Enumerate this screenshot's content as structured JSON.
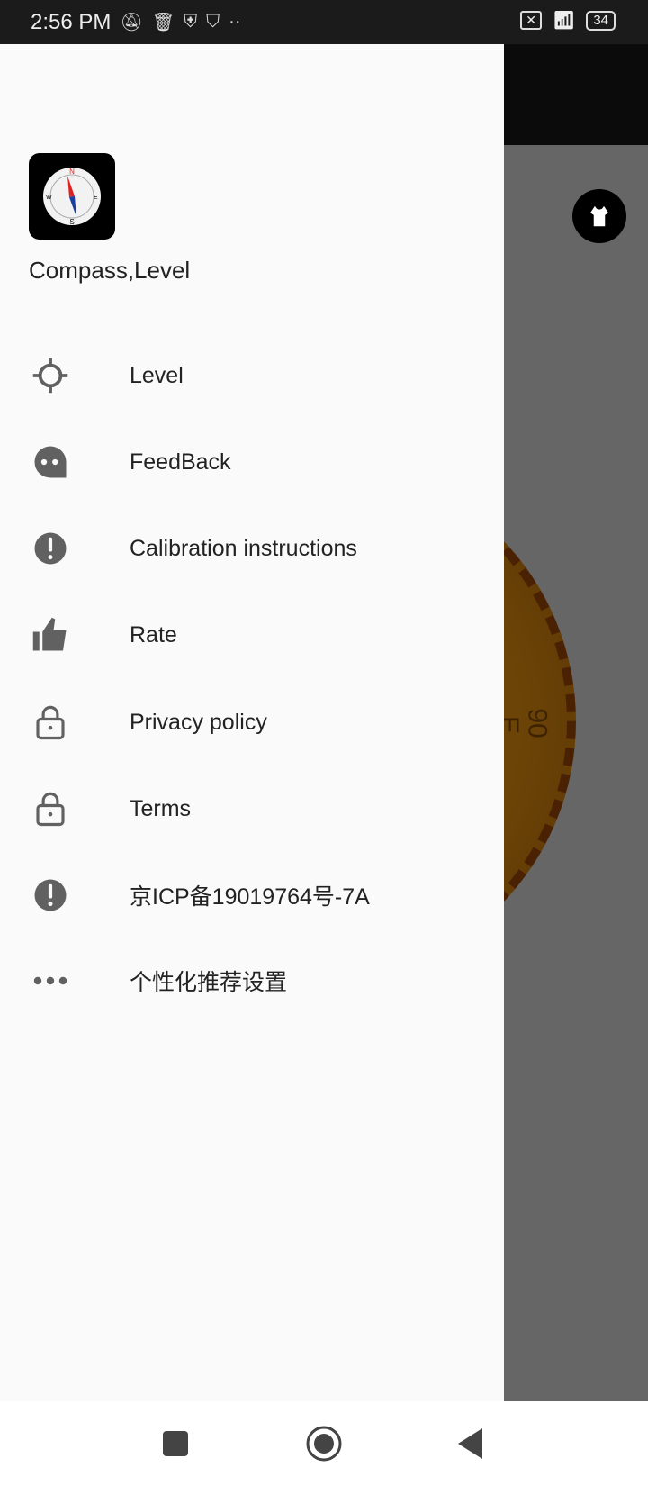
{
  "status_bar": {
    "time": "2:56 PM",
    "battery": "34",
    "icons": [
      "bell-off-icon",
      "trash-icon",
      "shield-bolt-icon",
      "shield-alert-icon",
      "more-dots-icon",
      "sim-x-icon",
      "wifi-icon",
      "battery-icon"
    ]
  },
  "background": {
    "compass_labels": [
      "90",
      "E"
    ]
  },
  "drawer": {
    "app_name": "Compass,Level",
    "items": [
      {
        "label": "Level",
        "icon": "crosshair-icon"
      },
      {
        "label": "FeedBack",
        "icon": "chat-bubble-icon"
      },
      {
        "label": "Calibration instructions",
        "icon": "alert-circle-icon"
      },
      {
        "label": "Rate",
        "icon": "thumbs-up-icon"
      },
      {
        "label": "Privacy policy",
        "icon": "lock-icon"
      },
      {
        "label": "Terms",
        "icon": "lock-icon"
      },
      {
        "label": "京ICP备19019764号-7A",
        "icon": "alert-circle-icon"
      },
      {
        "label": "个性化推荐设置",
        "icon": "more-horizontal-icon"
      }
    ]
  },
  "nav_bar": {
    "buttons": [
      "recents",
      "home",
      "back"
    ]
  }
}
